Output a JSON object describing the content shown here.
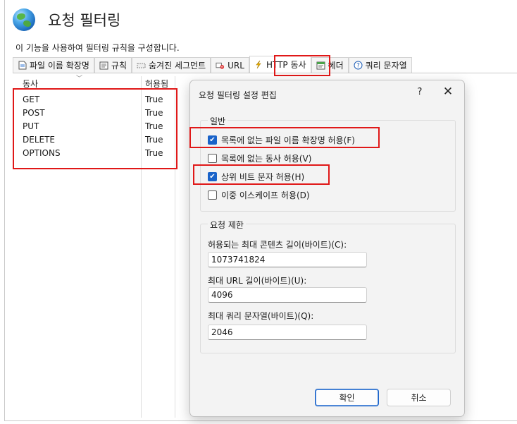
{
  "page": {
    "title": "요청 필터링",
    "description": "이 기능을 사용하여 필터링 규칙을 구성합니다."
  },
  "tabs": [
    {
      "label": "파일 이름 확장명",
      "icon": "file-extension-icon"
    },
    {
      "label": "규칙",
      "icon": "rules-icon"
    },
    {
      "label": "숨겨진 세그먼트",
      "icon": "hidden-segments-icon"
    },
    {
      "label": "URL",
      "icon": "url-deny-icon"
    },
    {
      "label": "HTTP 동사",
      "icon": "http-verb-icon"
    },
    {
      "label": "헤더",
      "icon": "headers-icon"
    },
    {
      "label": "쿼리 문자열",
      "icon": "query-string-icon"
    }
  ],
  "verbs_table": {
    "headers": {
      "verb": "동사",
      "allowed": "허용됨"
    },
    "rows": [
      {
        "verb": "GET",
        "allowed": "True"
      },
      {
        "verb": "POST",
        "allowed": "True"
      },
      {
        "verb": "PUT",
        "allowed": "True"
      },
      {
        "verb": "DELETE",
        "allowed": "True"
      },
      {
        "verb": "OPTIONS",
        "allowed": "True"
      }
    ]
  },
  "dialog": {
    "title": "요청 필터링 설정 편집",
    "help": "?",
    "close": "✕",
    "general": {
      "legend": "일반",
      "options": [
        {
          "label": "목록에 없는 파일 이름 확장명 허용(F)",
          "checked": true
        },
        {
          "label": "목록에 없는 동사 허용(V)",
          "checked": false
        },
        {
          "label": "상위 비트 문자 허용(H)",
          "checked": true
        },
        {
          "label": "이중 이스케이프 허용(D)",
          "checked": false
        }
      ]
    },
    "limits": {
      "legend": "요청 제한",
      "max_content_length_label": "허용되는 최대 콘텐츠 길이(바이트)(C):",
      "max_content_length_value": "1073741824",
      "max_url_label": "최대 URL 길이(바이트)(U):",
      "max_url_value": "4096",
      "max_query_label": "최대 쿼리 문자열(바이트)(Q):",
      "max_query_value": "2046"
    },
    "ok_label": "확인",
    "cancel_label": "취소"
  },
  "colors": {
    "highlight": "#e01818",
    "checkbox_checked": "#1a63c9"
  }
}
